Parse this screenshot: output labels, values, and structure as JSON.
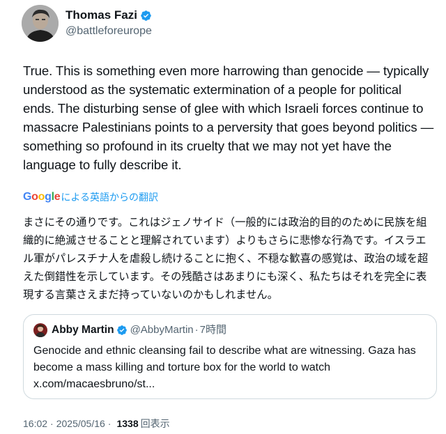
{
  "author": {
    "name": "Thomas Fazi",
    "handle": "@battleforeurope",
    "verified_color": "#1d9bf0"
  },
  "tweet": {
    "text": "True. This is something even more harrowing than genocide — typically understood as the systematic extermination of a people for political ends. The disturbing sense of glee with which Israeli forces continue to massacre Palestinians points to a perversity that goes beyond politics — something so profound in its cruelty that we may not yet have the language to fully describe it."
  },
  "translation": {
    "brand": "Google",
    "label": "による英語からの翻訳",
    "text": "まさにその通りです。これはジェノサイド（一般的には政治的目的のために民族を組織的に絶滅させることと理解されています）よりもさらに悲惨な行為です。イスラエル軍がパレスチナ人を虐殺し続けることに抱く、不穏な歓喜の感覚は、政治の域を超えた倒錯性を示しています。その残酷さはあまりにも深く、私たちはそれを完全に表現する言葉さえまだ持っていないのかもしれません。"
  },
  "quote": {
    "name": "Abby Martin",
    "handle": "@AbbyMartin",
    "separator": "·",
    "time": "7時間",
    "text": "Genocide and ethnic cleansing fail to describe what are witnessing. Gaza has become a mass killing and torture box for the world to watch x.com/macaesbruno/st..."
  },
  "meta": {
    "time": "16:02",
    "separator": "·",
    "date": "2025/05/16",
    "views_count": "1338",
    "views_label": "回表示"
  },
  "colors": {
    "accent": "#1d9bf0",
    "muted": "#536471",
    "text": "#0f1419",
    "border": "#cfd9de"
  }
}
